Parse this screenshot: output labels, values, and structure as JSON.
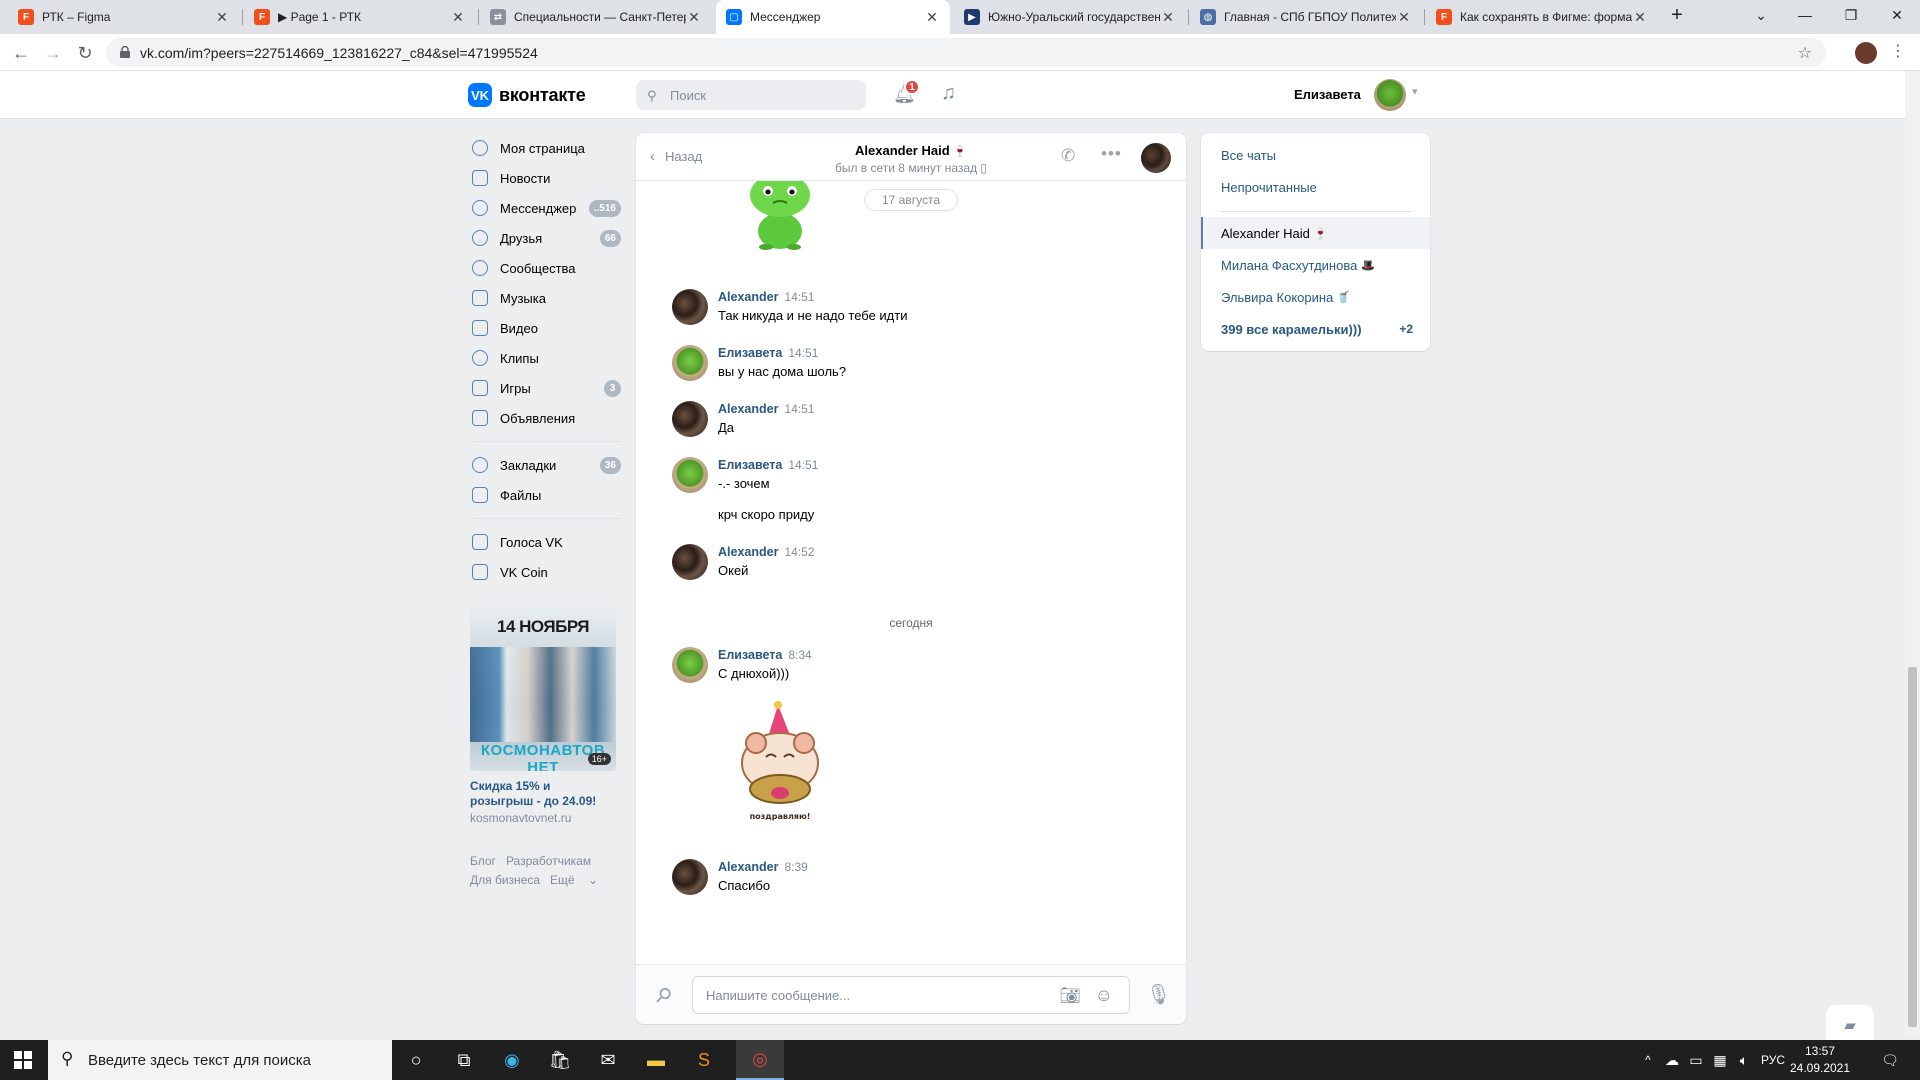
{
  "browser": {
    "tabs": [
      {
        "title": "РТК – Figma",
        "icon": "figma-icon",
        "color": "#f24e1e"
      },
      {
        "title": "▶ Page 1 - РТК",
        "icon": "figma-icon",
        "color": "#f24e1e"
      },
      {
        "title": "Специальности — Санкт-Петер",
        "icon": "link-icon",
        "color": "#5f6368"
      },
      {
        "title": "Мессенджер",
        "icon": "vk-chat-icon",
        "color": "#0077ff"
      },
      {
        "title": "Южно-Уральский государствен",
        "icon": "university-icon",
        "color": "#1e3a6e"
      },
      {
        "title": "Главная - СПб ГБПОУ Политех",
        "icon": "globe-icon",
        "color": "#4a6fa5"
      },
      {
        "title": "Как сохранять в Фигме: форма",
        "icon": "figma-icon",
        "color": "#f24e1e"
      }
    ],
    "url": "vk.com/im?peers=227514669_123816227_c84&sel=471995524"
  },
  "header": {
    "logo": "вконтакте",
    "search_placeholder": "Поиск",
    "notifications_count": "1",
    "user_name": "Елизавета"
  },
  "menu": {
    "items": [
      {
        "label": "Моя страница",
        "badge": ""
      },
      {
        "label": "Новости",
        "badge": ""
      },
      {
        "label": "Мессенджер",
        "badge": "..516"
      },
      {
        "label": "Друзья",
        "badge": "66"
      },
      {
        "label": "Сообщества",
        "badge": ""
      },
      {
        "label": "Музыка",
        "badge": ""
      },
      {
        "label": "Видео",
        "badge": ""
      },
      {
        "label": "Клипы",
        "badge": ""
      },
      {
        "label": "Игры",
        "badge": "3"
      },
      {
        "label": "Объявления",
        "badge": ""
      }
    ],
    "items2": [
      {
        "label": "Закладки",
        "badge": "36"
      },
      {
        "label": "Файлы",
        "badge": ""
      }
    ],
    "items3": [
      {
        "label": "Голоса VK"
      },
      {
        "label": "VK Coin"
      }
    ]
  },
  "ad": {
    "image_headline": "14 НОЯБРЯ",
    "image_footer": "КОСМОНАВТОВ НЕТ",
    "age_rating": "16+",
    "title": "Скидка 15% и розыгрыш - до 24.09!",
    "site": "kosmonavtovnet.ru"
  },
  "footer_links": [
    "Блог",
    "Разработчикам",
    "Для бизнеса",
    "Ещё"
  ],
  "chat": {
    "back_label": "Назад",
    "peer_name": "Alexander Haid",
    "peer_status": "был в сети 8 минут назад",
    "date1": "17 августа",
    "date2": "сегодня",
    "messages": [
      {
        "author": "Alexander",
        "time": "14:51",
        "lines": [
          "Так никуда и не надо тебе идти"
        ]
      },
      {
        "author": "Елизавета",
        "time": "14:51",
        "lines": [
          "вы у нас дома шоль?"
        ]
      },
      {
        "author": "Alexander",
        "time": "14:51",
        "lines": [
          "Да"
        ]
      },
      {
        "author": "Елизавета",
        "time": "14:51",
        "lines": [
          "-.- зочем",
          "крч скоро приду"
        ]
      },
      {
        "author": "Alexander",
        "time": "14:52",
        "lines": [
          "Окей"
        ]
      },
      {
        "author": "Елизавета",
        "time": "8:34",
        "lines": [
          "С днюхой)))"
        ]
      },
      {
        "author": "Alexander",
        "time": "8:39",
        "lines": [
          "Спасибо"
        ]
      }
    ],
    "sticker_caption": "поздравляю!",
    "input_placeholder": "Напишите сообщение..."
  },
  "right_panel": {
    "all_chats": "Все чаты",
    "unread": "Непрочитанные",
    "chats": [
      {
        "name": "Alexander Haid",
        "emoji": "🍷",
        "count": ""
      },
      {
        "name": "Милана Фасхутдинова",
        "emoji": "🎩",
        "count": ""
      },
      {
        "name": "Эльвира Кокорина",
        "emoji": "🥤",
        "count": ""
      },
      {
        "name": "399 все карамельки)))",
        "emoji": "",
        "count": "+2"
      }
    ]
  },
  "taskbar": {
    "search_placeholder": "Введите здесь текст для поиска",
    "lang": "РУС",
    "time": "13:57",
    "date": "24.09.2021",
    "notifications": "1"
  }
}
